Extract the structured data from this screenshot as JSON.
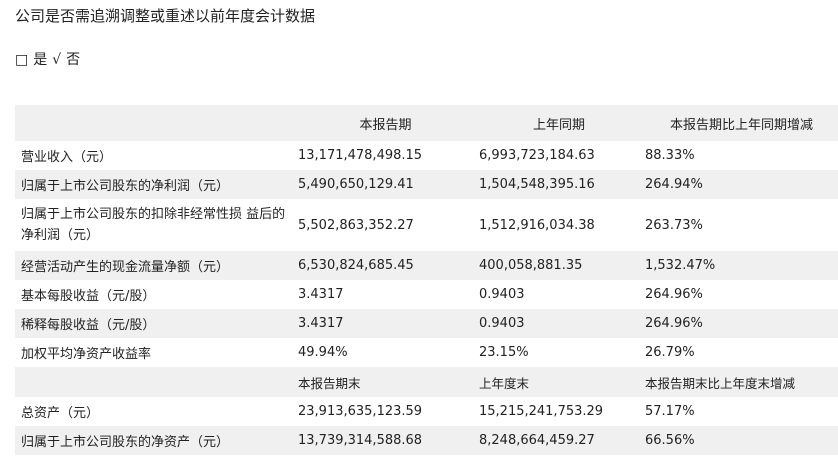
{
  "heading": "公司是否需追溯调整或重述以前年度会计数据",
  "answer": {
    "box": "□",
    "yes": "是",
    "check": "√",
    "no": "否"
  },
  "table": {
    "header": [
      "",
      "本报告期",
      "上年同期",
      "本报告期比上年同期增减"
    ],
    "rows": [
      {
        "label": "营业收入（元）",
        "current": "13,171,478,498.15",
        "prior": "6,993,723,184.63",
        "change": "88.33%"
      },
      {
        "label": "归属于上市公司股东的净利润（元）",
        "current": "5,490,650,129.41",
        "prior": "1,504,548,395.16",
        "change": "264.94%"
      },
      {
        "label": "归属于上市公司股东的扣除非经常性损 益后的净利润（元）",
        "current": "5,502,863,352.27",
        "prior": "1,512,916,034.38",
        "change": "263.73%"
      },
      {
        "label": "经营活动产生的现金流量净额（元）",
        "current": "6,530,824,685.45",
        "prior": "400,058,881.35",
        "change": "1,532.47%"
      },
      {
        "label": "基本每股收益（元/股）",
        "current": "3.4317",
        "prior": "0.9403",
        "change": "264.96%"
      },
      {
        "label": "稀释每股收益（元/股）",
        "current": "3.4317",
        "prior": "0.9403",
        "change": "264.96%"
      },
      {
        "label": "加权平均净资产收益率",
        "current": "49.94%",
        "prior": "23.15%",
        "change": "26.79%"
      }
    ],
    "subheader": [
      "",
      "本报告期末",
      "上年度末",
      "本报告期末比上年度末增减"
    ],
    "rows2": [
      {
        "label": "总资产（元）",
        "current": "23,913,635,123.59",
        "prior": "15,215,241,753.29",
        "change": "57.17%"
      },
      {
        "label": "归属于上市公司股东的净资产（元）",
        "current": "13,739,314,588.68",
        "prior": "8,248,664,459.27",
        "change": "66.56%"
      }
    ]
  }
}
